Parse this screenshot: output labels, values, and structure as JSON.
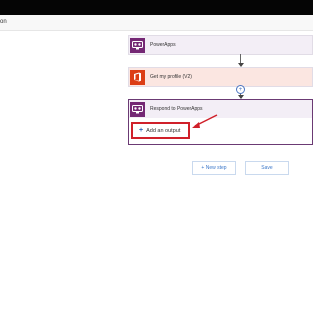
{
  "header": {
    "partial_text": "on"
  },
  "flow": {
    "steps": [
      {
        "title": "PowerApps",
        "icon": "powerapps-icon"
      },
      {
        "title": "Get my profile (V2)",
        "icon": "office-icon"
      },
      {
        "title": "Respond to PowerApps",
        "icon": "powerapps-icon"
      }
    ],
    "insert_symbol": "+",
    "add_output_label": "Add an output",
    "add_output_plus": "+"
  },
  "actions": {
    "new_step_label": "+ New step",
    "save_label": "Save"
  },
  "colors": {
    "powerapps": "#742774",
    "office": "#dc3e15",
    "highlight": "#d0202a",
    "link": "#3d78c9"
  }
}
